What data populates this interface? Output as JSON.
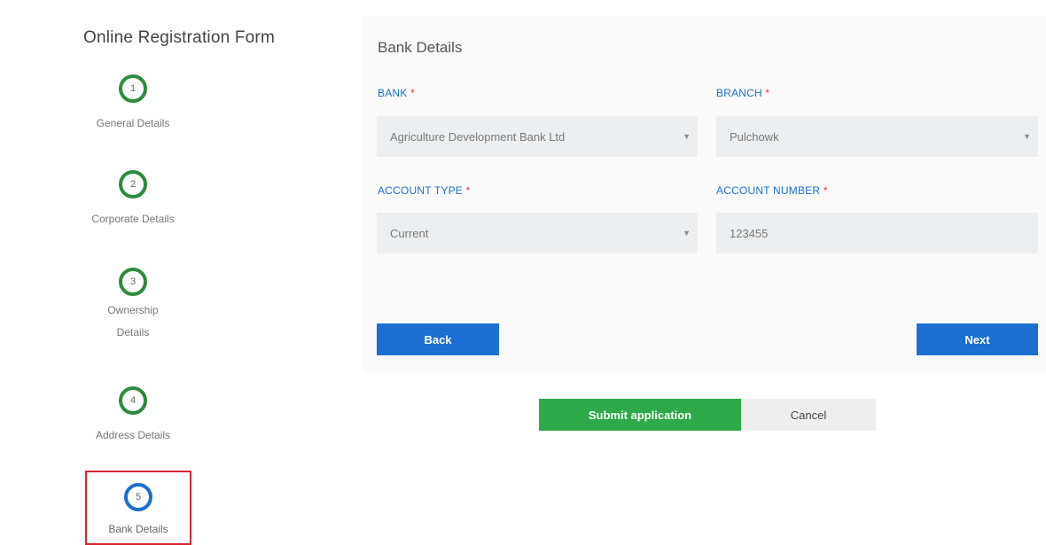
{
  "sidebar": {
    "title": "Online Registration Form",
    "steps": [
      {
        "number": "1",
        "label": "General Details"
      },
      {
        "number": "2",
        "label": "Corporate Details"
      },
      {
        "number": "3",
        "label_line1": "Ownership",
        "label_line2": "Details"
      },
      {
        "number": "4",
        "label": "Address Details"
      },
      {
        "number": "5",
        "label": "Bank Details"
      }
    ]
  },
  "form": {
    "title": "Bank Details",
    "required_marker": "*",
    "bank": {
      "label": "BANK",
      "value": "Agriculture Development Bank Ltd"
    },
    "branch": {
      "label": "BRANCH",
      "value": "Pulchowk"
    },
    "account_type": {
      "label": "ACCOUNT TYPE",
      "value": "Current"
    },
    "account_number": {
      "label": "ACCOUNT NUMBER",
      "value": "123455"
    },
    "back_label": "Back",
    "next_label": "Next"
  },
  "actions": {
    "submit_label": "Submit application",
    "cancel_label": "Cancel"
  },
  "colors": {
    "accent": "#1c6fd1",
    "complete_step": "#2e8b3e",
    "submit": "#2da94a",
    "highlight": "#d6262f"
  }
}
